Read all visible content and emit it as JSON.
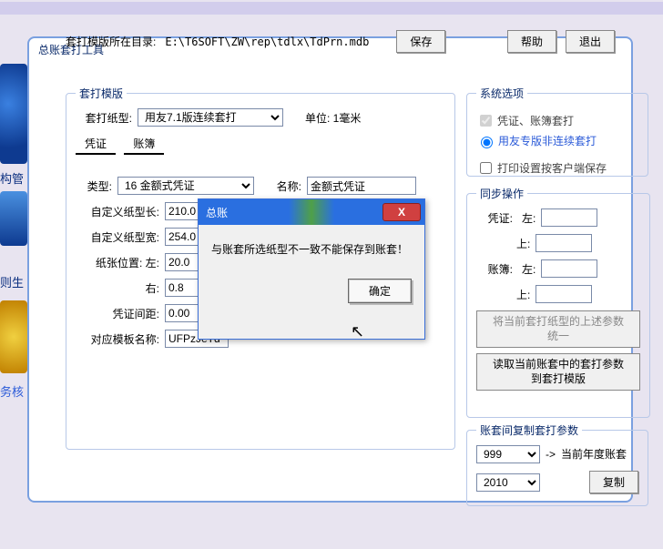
{
  "window": {
    "title": "总账套打工具"
  },
  "template": {
    "legend": "套打模版",
    "paper_type_label": "套打纸型:",
    "paper_type_value": "用友7.1版连续套打",
    "unit_label": "单位: 1毫米",
    "tab_voucher": "凭证",
    "tab_book": "账簿",
    "type_label": "类型:",
    "type_value": "16 金额式凭证",
    "name_label": "名称:",
    "name_value": "金额式凭证",
    "custom_len_label": "自定义纸型长:",
    "custom_len_value": "210.0",
    "custom_wid_label": "自定义纸型宽:",
    "custom_wid_value": "254.0",
    "pos_left_label": "纸张位置: 左:",
    "pos_left_value": "20.0",
    "pos_right_label": "右:",
    "pos_right_value": "0.8",
    "gap_label": "凭证间距:",
    "gap_value": "0.00",
    "tmpl_name_label": "对应模板名称:",
    "tmpl_name_value": "UFPzJeTd"
  },
  "sysopt": {
    "legend": "系统选项",
    "chk1": "凭证、账簿套打",
    "radio1": "用友专版非连续套打",
    "chk2": "打印设置按客户端保存"
  },
  "sync": {
    "legend": "同步操作",
    "voucher_label": "凭证:",
    "book_label": "账簿:",
    "left_label": "左:",
    "top_label": "上:",
    "btn_unify": "将当前套打纸型的上述参数\n统一",
    "btn_read": "读取当前账套中的套打参数\n到套打模版"
  },
  "copy": {
    "legend": "账套间复制套打参数",
    "sel1": "999",
    "arrow": "->",
    "dest": "当前年度账套",
    "sel2": "2010",
    "btn": "复制"
  },
  "bottom": {
    "path_label": "套打模版所在目录:",
    "path_value": "E:\\T6SOFT\\ZW\\rep\\tdlx\\TdPrn.mdb",
    "save": "保存",
    "help": "帮助",
    "exit": "退出"
  },
  "modal": {
    "title": "总账",
    "message": "与账套所选纸型不一致不能保存到账套！",
    "ok": "确定",
    "close_icon": "X"
  },
  "edge": {
    "t1": "构管",
    "t2": "则生",
    "t3": "务核"
  }
}
